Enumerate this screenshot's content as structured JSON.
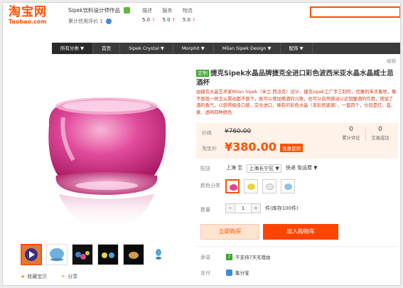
{
  "header": {
    "logo_main": "淘宝网",
    "logo_sub": "Taobao.com",
    "shop_name": "Sipek饮料设计师作品",
    "shop_credit": "累计信用评价 1",
    "ratings": [
      {
        "label": "描述",
        "score": "5.0"
      },
      {
        "label": "服务",
        "score": "5.0"
      },
      {
        "label": "物流",
        "score": "5.0"
      }
    ]
  },
  "nav": {
    "items": [
      "所有分类 ▼",
      "首页",
      "Sipek Crystal ▼",
      "Morphit ▼",
      "Milan Sipek Design ▼",
      "配饰 ▼"
    ]
  },
  "edit_label": "编辑",
  "product": {
    "tag": "定制",
    "title": "捷克Sipek水晶品牌捷克全进口彩色波西米亚水晶水晶威士忌酒杯",
    "description": "由捷克水晶艺术家Milan Sipek（米兰.西派克）设计，捷克sipek工厂手工制作，优雅的单点着地，像不倒翁一样怎么晃动都不倒下，既可以增加喝酒的兴致，也可以自然感动以达到醒酒的作用，增加了酒的香气，以获得极佳口感，完全进口，稀有的彩色水晶（非彩色玻璃），一套四个，分别是红、蓝、黄、透明四种颜色"
  },
  "price": {
    "orig_label": "价格",
    "orig_value": "¥760.00",
    "sale_label": "淘宝价",
    "sale_value": "¥380.00",
    "promo": "优惠促销",
    "stats": [
      {
        "num": "0",
        "label": "累计评论"
      },
      {
        "num": "0",
        "label": "交易成功"
      }
    ]
  },
  "shipping": {
    "label": "配送",
    "origin": "上海 至",
    "dest": "上海长宁区 ▼",
    "method": "快递 免运费 ▼"
  },
  "color": {
    "label": "颜色分类",
    "swatches": [
      "#e0459a",
      "#e8d34a",
      "#e8e8e8",
      "#8ec4e6"
    ]
  },
  "quantity": {
    "label": "数量",
    "value": "1",
    "minus": "−",
    "plus": "+",
    "unit": "件(库存100件)"
  },
  "buttons": {
    "buy": "立即购买",
    "cart": "加入购物车"
  },
  "service": {
    "promise_label": "承诺",
    "promise_text": "不支持7天无理由",
    "pay_label": "支付",
    "pay_text": "集分宝"
  },
  "share": {
    "favorite": "收藏宝贝",
    "share": "分享"
  },
  "colors": {
    "accent": "#ff5000",
    "glass": "#e0459a"
  }
}
